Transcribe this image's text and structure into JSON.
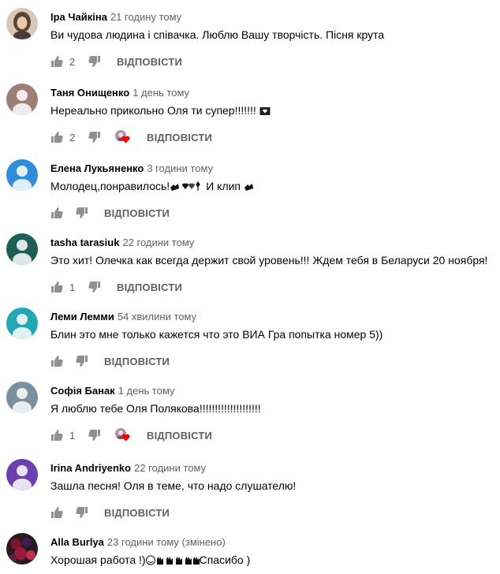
{
  "reply_label": "ВІДПОВІСТИ",
  "comments": [
    {
      "author": "Іра Чайкіна",
      "time": "21 годину тому",
      "text": "Ви чудова людина і співачка. Люблю Вашу творчість. Пісня крута",
      "likes": "2",
      "avatar_color": "#c9b6a3",
      "creator_heart": false
    },
    {
      "author": "Таня Онищенко",
      "time": "1 день тому",
      "text": "Нереально прикольно Оля ти супер!!!!!!! ",
      "likes": "2",
      "avatar_color": "#9e7f77",
      "creator_heart": true
    },
    {
      "author": "Елена Лукьяненко",
      "time": "3 години тому",
      "text": "Молодец,понравилось!",
      "text_suffix": "И клип ",
      "likes": "",
      "avatar_color": "#2f8ddb",
      "creator_heart": false
    },
    {
      "author": "tasha tarasiuk",
      "time": "22 години тому",
      "text": "Это хит! Олечка как всегда держит свой уровень!!! Ждем тебя в Беларуси 20 ноября!",
      "likes": "1",
      "avatar_color": "#1d5e56",
      "creator_heart": false
    },
    {
      "author": "Леми Лемми",
      "time": "54 хвилини тому",
      "text": "Блин это мне только кажется что это ВИА Гра попытка номер 5))",
      "likes": "",
      "avatar_color": "#23a7b5",
      "creator_heart": false
    },
    {
      "author": "Софія Банак",
      "time": "1 день тому",
      "text": "Я люблю тебе Оля Полякова!!!!!!!!!!!!!!!!!!!!",
      "likes": "1",
      "avatar_color": "#7b8f9c",
      "creator_heart": true
    },
    {
      "author": "Irina Andriyenko",
      "time": "22 години тому",
      "text": "Зашла песня! Оля в теме, что надо слушателю!",
      "likes": "",
      "avatar_color": "#6a3fb0",
      "creator_heart": false
    },
    {
      "author": "Alla Burlya",
      "time": "23 години тому (змінено)",
      "text": "Хорошая работа !)",
      "text_suffix": "Спасибо )",
      "likes": "",
      "avatar_color": "#3a1f2a",
      "creator_heart": false
    }
  ],
  "colors": {
    "text_primary": "#030303",
    "text_secondary": "#606060",
    "heart_red": "#ff0000"
  }
}
